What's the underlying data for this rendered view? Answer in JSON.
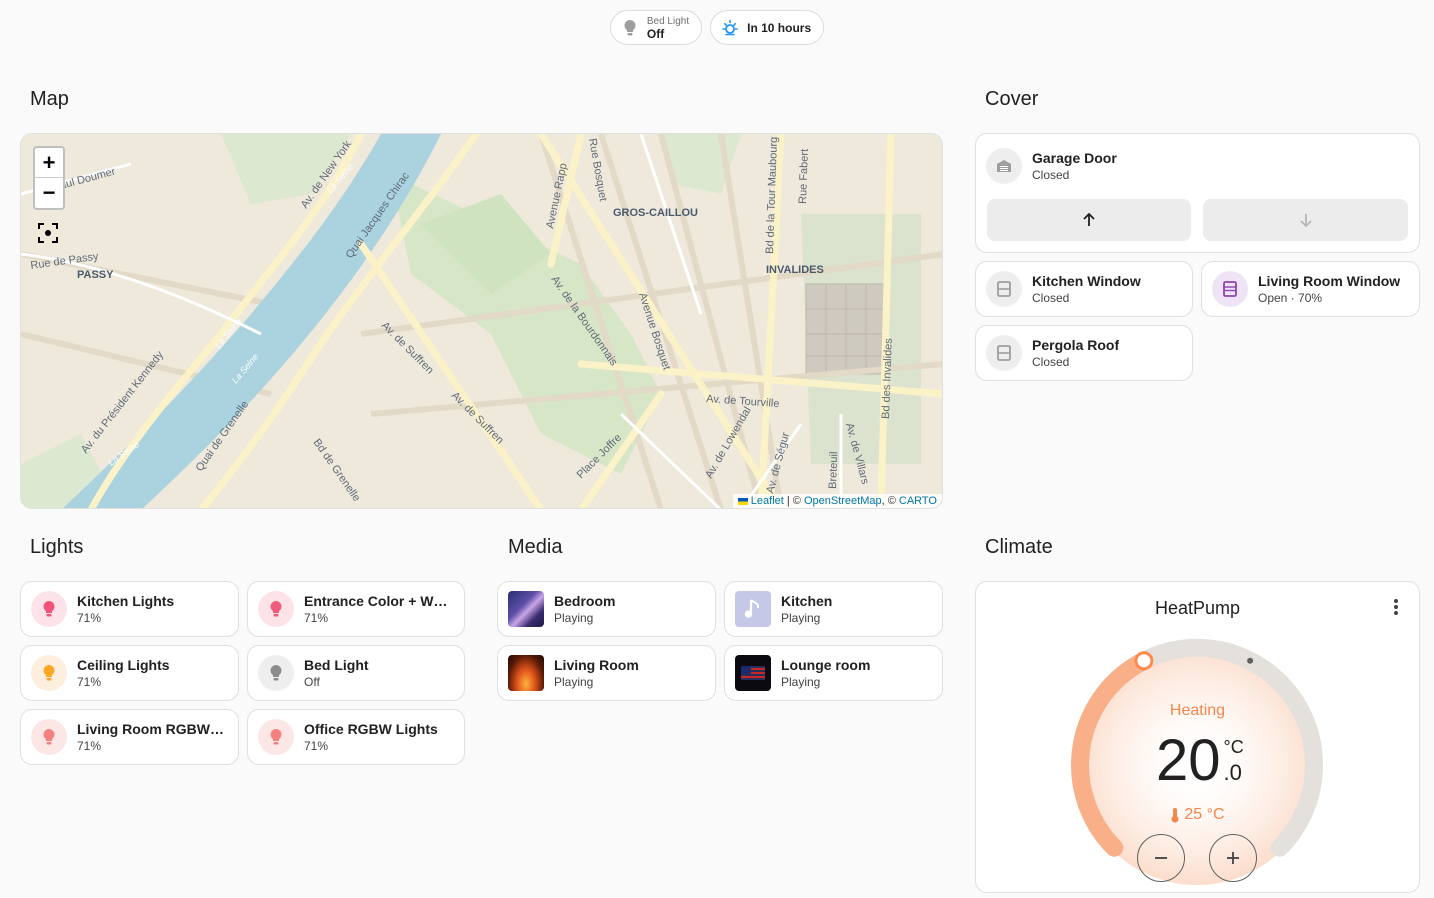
{
  "badges": [
    {
      "label": "Bed Light",
      "value": "Off",
      "icon": "bulb-icon"
    },
    {
      "label": "",
      "value": "In 10 hours",
      "icon": "weather-sun-icon"
    }
  ],
  "map": {
    "title": "Map",
    "zoom_in": "+",
    "zoom_out": "−",
    "attribution": {
      "leaflet": "Leaflet",
      "sep1": " | © ",
      "osm": "OpenStreetMap",
      "sep2": ", © ",
      "carto": "CARTO"
    },
    "labels": [
      "Av. de New York",
      "Quai Jacques Chirac",
      "Avenue Rapp",
      "Rue Bosquet",
      "Bd de la Tour Maubourg",
      "Rue Fabert",
      "GROS-CAILLOU",
      "INVALIDES",
      "Rue de Passy",
      "PASSY",
      "aul Doumer",
      "Av. de la Bourdonnais",
      "Avenue Bosquet",
      "Av. de Suffren",
      "Av. de Tourville",
      "Av. du Président Kennedy",
      "Quai de Grenelle",
      "Bd de Grenelle",
      "Place Joffre",
      "Av. de Lowendal",
      "Av. de Ségur",
      "Breteuil",
      "Av. de Villars",
      "Bd des Invalides",
      "La Seine"
    ]
  },
  "cover": {
    "title": "Cover",
    "garage": {
      "name": "Garage Door",
      "state": "Closed",
      "up_label": "up-arrow-icon",
      "down_label": "down-arrow-icon"
    },
    "items": [
      {
        "name": "Kitchen Window",
        "state": "Closed"
      },
      {
        "name": "Living Room Window",
        "state": "Open · 70%"
      },
      {
        "name": "Pergola Roof",
        "state": "Closed"
      }
    ]
  },
  "lights": {
    "title": "Lights",
    "items": [
      {
        "name": "Kitchen Lights",
        "state": "71%",
        "color": "#f06292"
      },
      {
        "name": "Entrance Color + White Lights",
        "state": "71%",
        "color": "#ef5b7a"
      },
      {
        "name": "Ceiling Lights",
        "state": "71%",
        "color": "#ffa726"
      },
      {
        "name": "Bed Light",
        "state": "Off",
        "color": "#8c8c8c"
      },
      {
        "name": "Living Room RGBWW Lights",
        "state": "71%",
        "color": "#f48080"
      },
      {
        "name": "Office RGBW Lights",
        "state": "71%",
        "color": "#f48080"
      }
    ]
  },
  "media": {
    "title": "Media",
    "items": [
      {
        "name": "Bedroom",
        "state": "Playing"
      },
      {
        "name": "Kitchen",
        "state": "Playing"
      },
      {
        "name": "Living Room",
        "state": "Playing"
      },
      {
        "name": "Lounge room",
        "state": "Playing"
      }
    ]
  },
  "climate": {
    "title": "Climate",
    "device": "HeatPump",
    "mode": "Heating",
    "target_int": "20",
    "target_dec": ".0",
    "unit": "°C",
    "current": "25 °C",
    "target_fraction": 0.4,
    "colors": {
      "heat": "#ff9a5c",
      "arc": "#f9b089"
    }
  }
}
